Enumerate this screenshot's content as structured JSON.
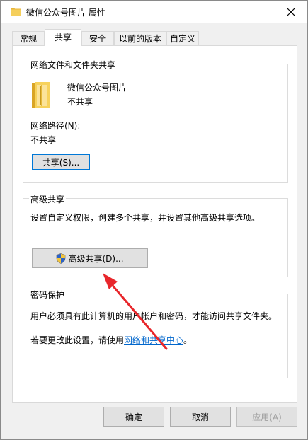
{
  "window": {
    "title": "微信公众号图片 属性"
  },
  "tabs": [
    {
      "label": "常规"
    },
    {
      "label": "共享"
    },
    {
      "label": "安全"
    },
    {
      "label": "以前的版本"
    },
    {
      "label": "自定义"
    }
  ],
  "network_sharing": {
    "group_title": "网络文件和文件夹共享",
    "folder_name": "微信公众号图片",
    "folder_status": "不共享",
    "path_label": "网络路径(N):",
    "path_value": "不共享",
    "share_button": "共享(S)..."
  },
  "advanced_sharing": {
    "group_title": "高级共享",
    "description": "设置自定义权限，创建多个共享，并设置其他高级共享选项。",
    "button": "高级共享(D)..."
  },
  "password_protection": {
    "group_title": "密码保护",
    "description": "用户必须具有此计算机的用户帐户和密码，才能访问共享文件夹。",
    "change_prefix": "若要更改此设置，请使用",
    "change_link": "网络和共享中心",
    "change_suffix": "。"
  },
  "footer": {
    "ok": "确定",
    "cancel": "取消",
    "apply": "应用(A)"
  },
  "icons": {
    "title": "folder-icon",
    "close": "close-icon",
    "folder": "folder-icon",
    "shield": "uac-shield-icon"
  },
  "colors": {
    "accent": "#0078d7",
    "link": "#0066cc",
    "annotation_arrow": "#e8262b"
  }
}
